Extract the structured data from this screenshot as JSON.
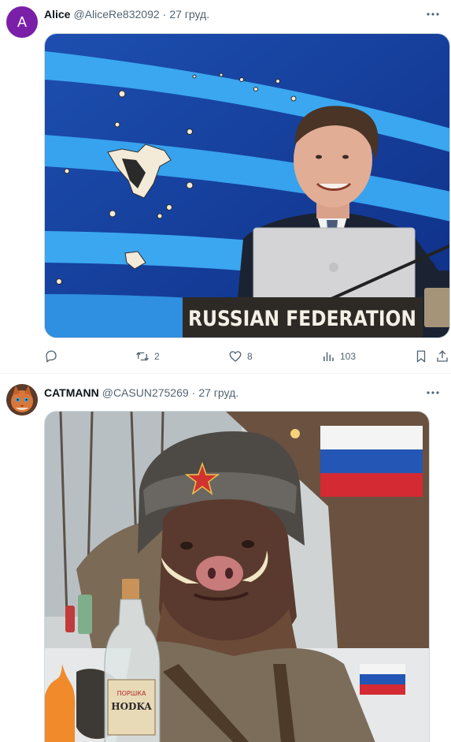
{
  "tweets": [
    {
      "avatar_letter": "A",
      "avatar_color": "#7a1fa8",
      "name": "Alice",
      "handle": "@AliceRe832092",
      "separator": "·",
      "date": "27 груд.",
      "image": {
        "caption_plaque": "RUSSIAN FEDERATION"
      },
      "actions": {
        "reply_icon": "reply-icon",
        "retweet_icon": "retweet-icon",
        "retweet_count": "2",
        "like_icon": "heart-icon",
        "like_count": "8",
        "views_icon": "views-icon",
        "views_count": "103",
        "bookmark_icon": "bookmark-icon",
        "share_icon": "share-icon"
      }
    },
    {
      "avatar_icon": "cat-avatar",
      "name": "CATMANN",
      "handle": "@CASUN275269",
      "separator": "·",
      "date": "27 груд.",
      "image": {
        "bottle_label_top": "ПОРШКА",
        "bottle_label_main": "HODKA"
      }
    }
  ],
  "colors": {
    "text_primary": "#0f1419",
    "text_secondary": "#536471",
    "border": "#eff3f4"
  }
}
